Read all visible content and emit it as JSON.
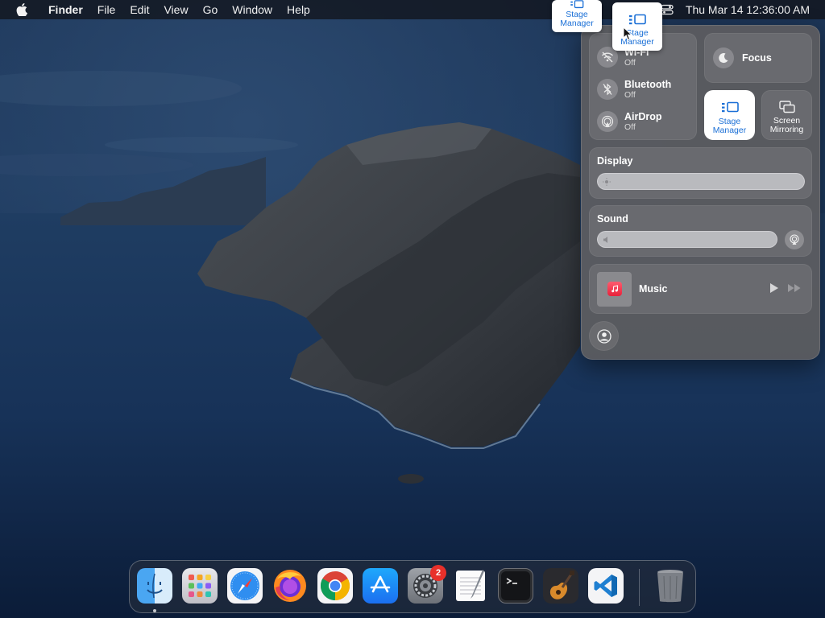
{
  "menubar": {
    "app_name": "Finder",
    "menus": [
      "File",
      "Edit",
      "View",
      "Go",
      "Window",
      "Help"
    ],
    "clock": "Thu Mar 14  12:36:00 AM"
  },
  "tooltips": {
    "stage_manager_a": "Stage Manager",
    "stage_manager_b": "Stage Manager"
  },
  "control_center": {
    "wifi": {
      "label": "Wi-Fi",
      "status": "Off"
    },
    "bluetooth": {
      "label": "Bluetooth",
      "status": "Off"
    },
    "airdrop": {
      "label": "AirDrop",
      "status": "Off"
    },
    "focus": {
      "label": "Focus"
    },
    "stage_manager": {
      "label": "Stage Manager"
    },
    "screen_mirroring": {
      "label": "Screen Mirroring"
    },
    "display": {
      "label": "Display",
      "level": 1.0
    },
    "sound": {
      "label": "Sound",
      "level": 1.0
    },
    "music": {
      "label": "Music"
    }
  },
  "dock": {
    "icons": [
      "finder-icon",
      "launchpad-icon",
      "safari-icon",
      "firefox-icon",
      "chrome-icon",
      "app-store-icon",
      "system-settings-icon",
      "textedit-icon",
      "terminal-icon",
      "garageband-icon",
      "vscode-icon",
      "trash-icon"
    ],
    "settings_badge": "2"
  },
  "colors": {
    "accent_blue": "#1a6fd6",
    "badge_red": "#e8302a",
    "panel_bg": "#5c5c60"
  }
}
